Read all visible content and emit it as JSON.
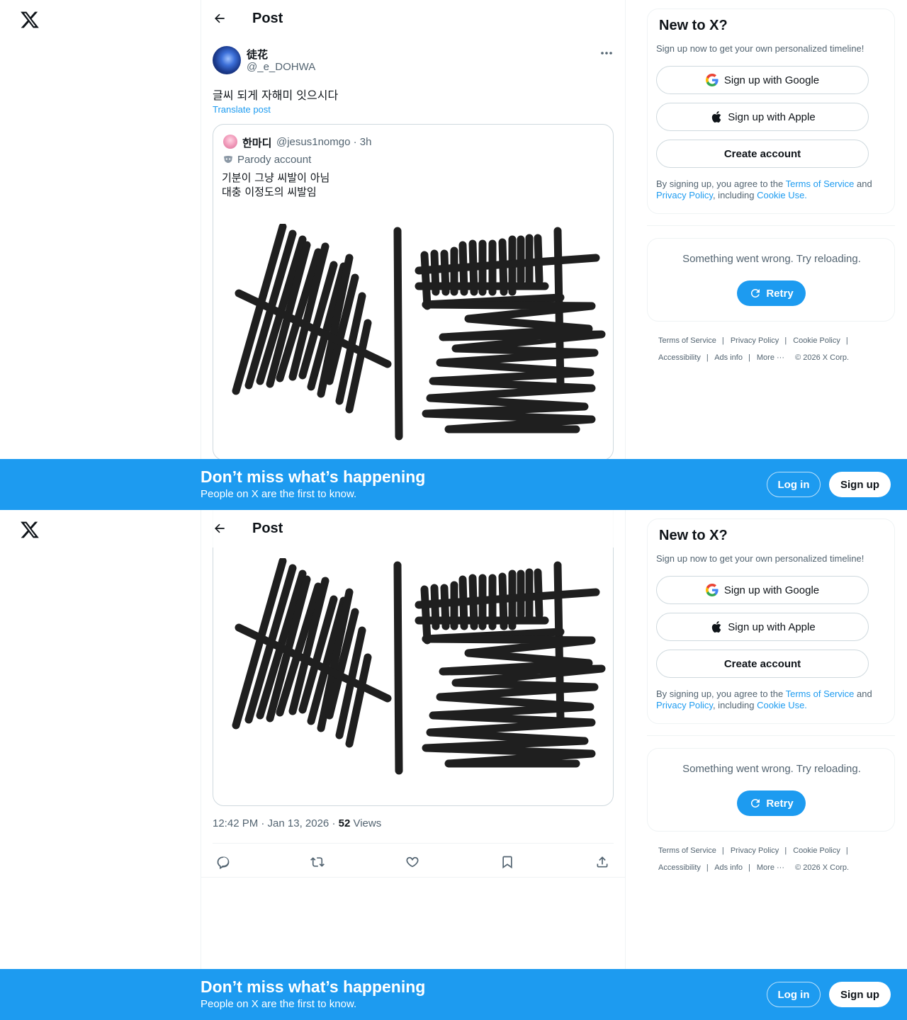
{
  "header": {
    "title": "Post"
  },
  "post": {
    "author_name": "徒花",
    "author_handle": "@_e_DOHWA",
    "text": "글씨 되게 자해미 잇으시다",
    "translate_label": "Translate post",
    "timestamp": "12:42 PM · Jan 13, 2026 · ",
    "views_count": "52",
    "views_label": " Views"
  },
  "quote": {
    "author_name": "한마디",
    "author_handle_time": "@jesus1nomgo · 3h",
    "parody_label": "Parody account",
    "text_line1": "기분이 그냥 씨발이 아님",
    "text_line2": "대충 이정도의 씨발임"
  },
  "actions": [
    "reply-icon",
    "repost-icon",
    "like-icon",
    "bookmark-icon",
    "share-icon"
  ],
  "signup_card": {
    "title": "New to X?",
    "subtitle": "Sign up now to get your own personalized timeline!",
    "google_label": "Sign up with Google",
    "apple_label": "Sign up with Apple",
    "create_label": "Create account",
    "legal_prefix": "By signing up, you agree to the ",
    "terms_link": "Terms of Service",
    "legal_and": " and ",
    "privacy_link": "Privacy Policy",
    "legal_including": ", including ",
    "cookie_link": "Cookie Use."
  },
  "error_card": {
    "message": "Something went wrong. Try reloading.",
    "retry_label": "Retry"
  },
  "footer": {
    "terms": "Terms of Service",
    "privacy": "Privacy Policy",
    "cookie": "Cookie Policy",
    "accessibility": "Accessibility",
    "ads": "Ads info",
    "more": "More ···",
    "copyright": "© 2026 X Corp."
  },
  "banner": {
    "title": "Don’t miss what’s happening",
    "subtitle": "People on X are the first to know.",
    "login_label": "Log in",
    "signup_label": "Sign up"
  },
  "colors": {
    "accent": "#1d9bf0",
    "text": "#0f1419",
    "muted": "#536471",
    "border": "#cfd9de"
  }
}
